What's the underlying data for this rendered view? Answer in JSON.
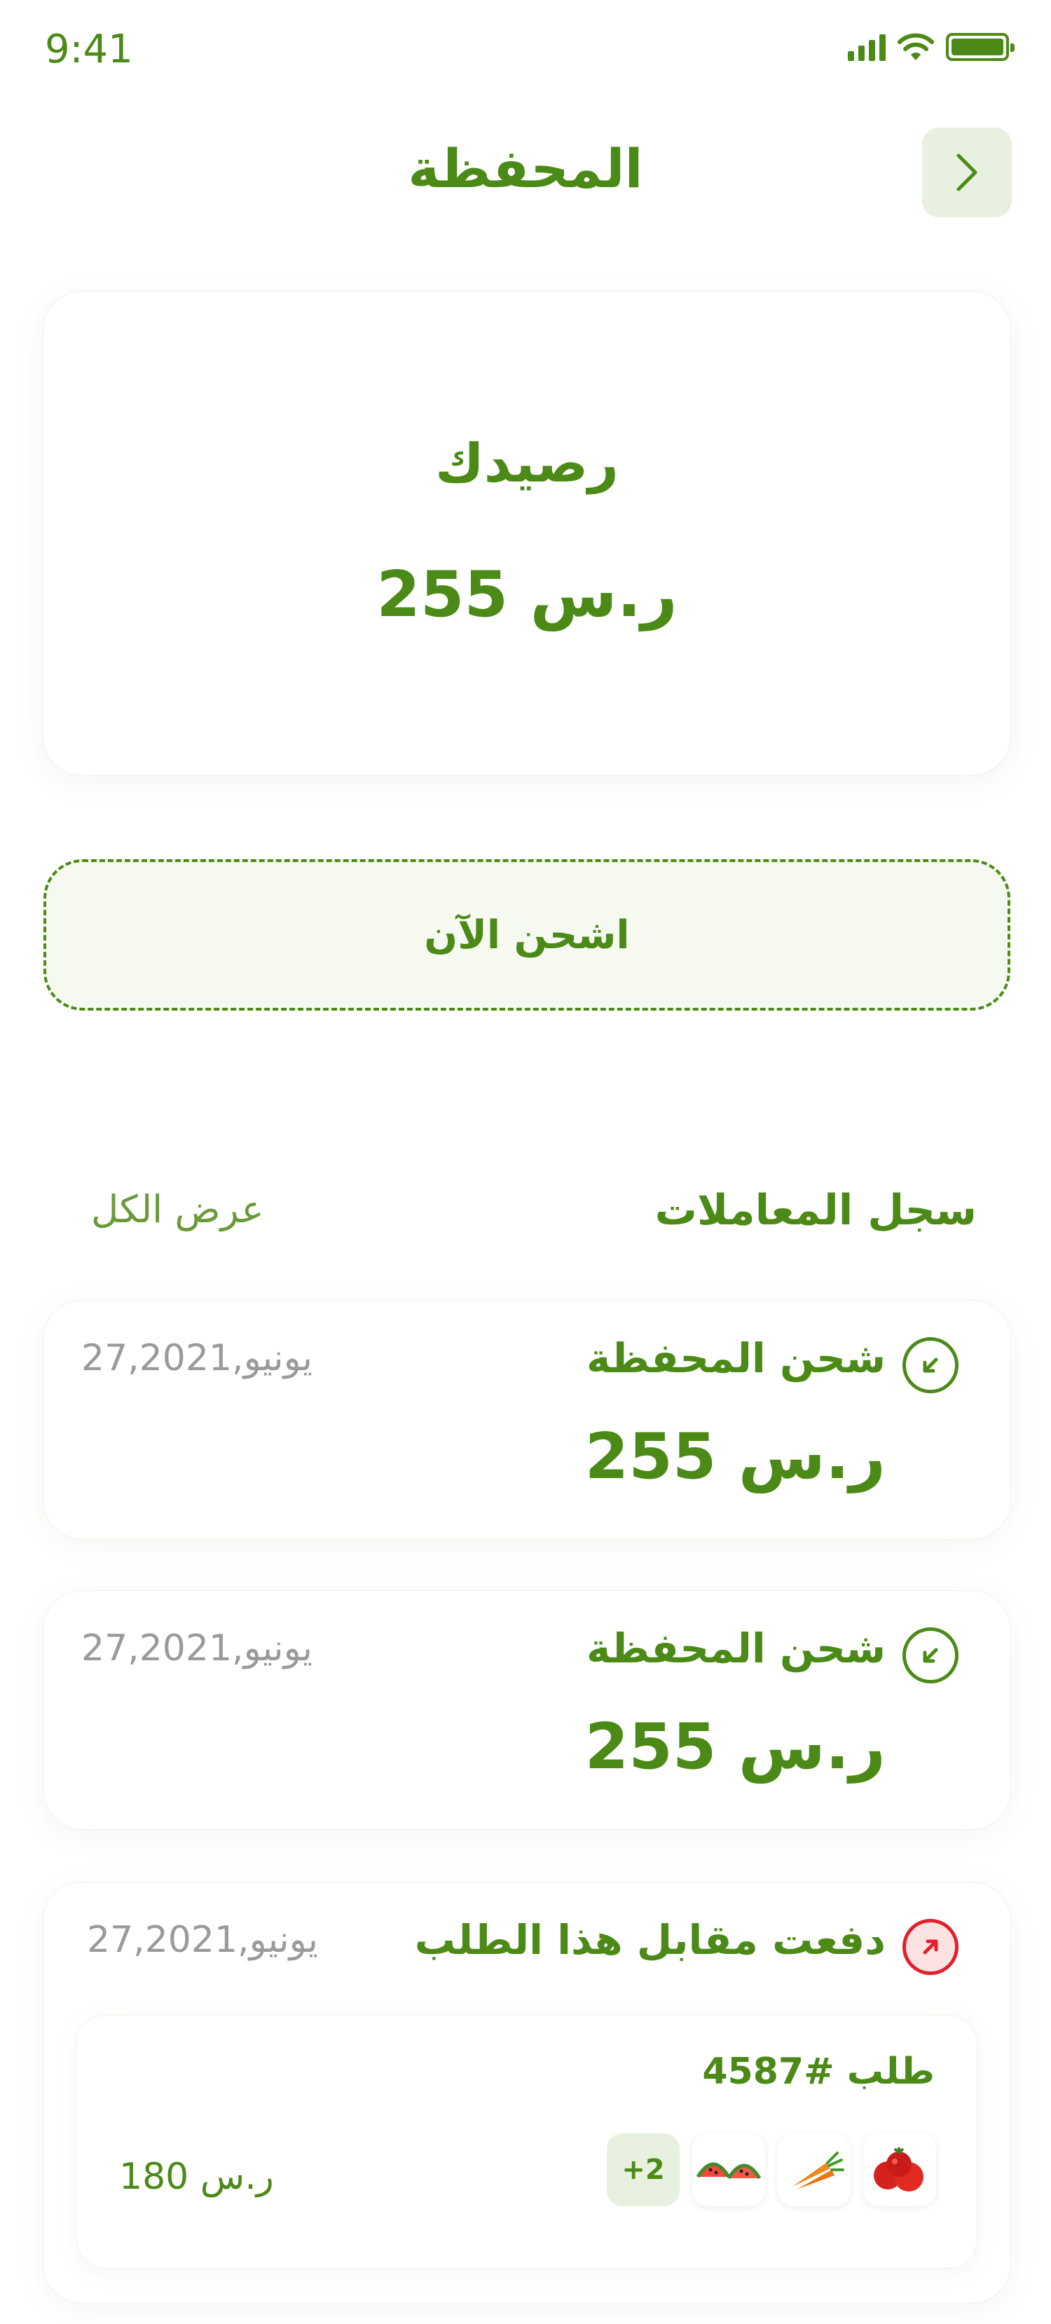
{
  "status_bar": {
    "time": "9:41"
  },
  "header": {
    "title": "المحفظة"
  },
  "balance": {
    "label": "رصيدك",
    "value": "255 ر.س"
  },
  "charge_button": {
    "label": "اشحن الآن"
  },
  "transactions_section": {
    "title": "سجل المعاملات",
    "view_all": "عرض الكل"
  },
  "transactions": [
    {
      "type": "in",
      "title": "شحن المحفظة",
      "date": "27,يونيو,2021",
      "amount": "255 ر.س"
    },
    {
      "type": "in",
      "title": "شحن المحفظة",
      "date": "27,يونيو,2021",
      "amount": "255 ر.س"
    },
    {
      "type": "out",
      "title": "دفعت مقابل هذا الطلب",
      "date": "27,يونيو,2021",
      "order": {
        "number": "طلب #4587",
        "price": "180 ر.س",
        "more_items": "+2",
        "items": [
          "tomato",
          "carrot",
          "watermelon"
        ]
      }
    }
  ],
  "colors": {
    "primary": "#4b8a16",
    "light_bg": "#e8f0df",
    "danger": "#e0202a"
  }
}
